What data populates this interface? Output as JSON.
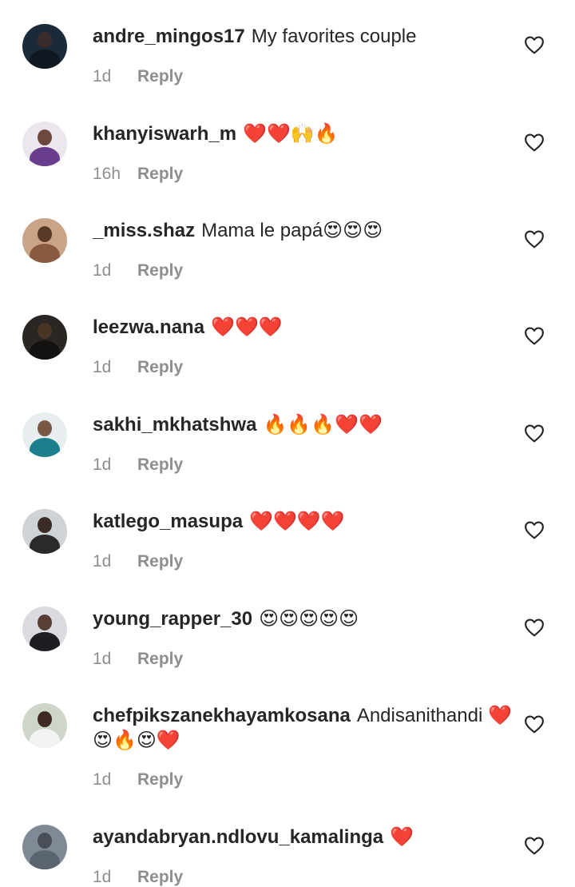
{
  "comments": [
    {
      "username": "andre_mingos17",
      "text": "My favorites couple",
      "time": "1d",
      "reply": "Reply",
      "avatar": {
        "bg": "#1b2a38",
        "head": "#3a2c2a",
        "body": "#0f1820"
      }
    },
    {
      "username": "khanyiswarh_m",
      "text": "❤️❤️🙌🔥",
      "time": "16h",
      "reply": "Reply",
      "avatar": {
        "bg": "#ece6ef",
        "head": "#6b4a3c",
        "body": "#6a3d8f"
      }
    },
    {
      "username": "_miss.shaz",
      "text": "Mama le papá😍😍😍",
      "time": "1d",
      "reply": "Reply",
      "avatar": {
        "bg": "#c9a487",
        "head": "#5a3a28",
        "body": "#8a5a3e"
      }
    },
    {
      "username": "leezwa.nana",
      "text": "❤️❤️❤️",
      "time": "1d",
      "reply": "Reply",
      "avatar": {
        "bg": "#2a2622",
        "head": "#4a3426",
        "body": "#141210"
      }
    },
    {
      "username": "sakhi_mkhatshwa",
      "text": "🔥🔥🔥❤️❤️",
      "time": "1d",
      "reply": "Reply",
      "avatar": {
        "bg": "#e8eef0",
        "head": "#7a5844",
        "body": "#1e7f8c"
      }
    },
    {
      "username": "katlego_masupa",
      "text": "❤️❤️❤️❤️",
      "time": "1d",
      "reply": "Reply",
      "avatar": {
        "bg": "#cfd3d6",
        "head": "#3a2c24",
        "body": "#2a2a2a"
      }
    },
    {
      "username": "young_rapper_30",
      "text": "😍😍😍😍😍",
      "time": "1d",
      "reply": "Reply",
      "avatar": {
        "bg": "#d9dbe0",
        "head": "#5a4034",
        "body": "#1e1e22"
      }
    },
    {
      "username": "chefpikszanekhayamkosana",
      "text": "Andisanithandi ❤️😍🔥😍❤️",
      "time": "1d",
      "reply": "Reply",
      "avatar": {
        "bg": "#cdd6c9",
        "head": "#3e2a22",
        "body": "#f2f2f2"
      }
    },
    {
      "username": "ayandabryan.ndlovu_kamalinga",
      "text": "❤️",
      "time": "1d",
      "reply": "Reply",
      "avatar": {
        "bg": "#7f8a96",
        "head": "#4a4e56",
        "body": "#5a6470"
      }
    }
  ],
  "icons": {
    "avatar": "profile-picture",
    "like": "heart-outline-icon"
  },
  "colors": {
    "text": "#262626",
    "meta": "#8e8e8e",
    "background": "#ffffff"
  }
}
